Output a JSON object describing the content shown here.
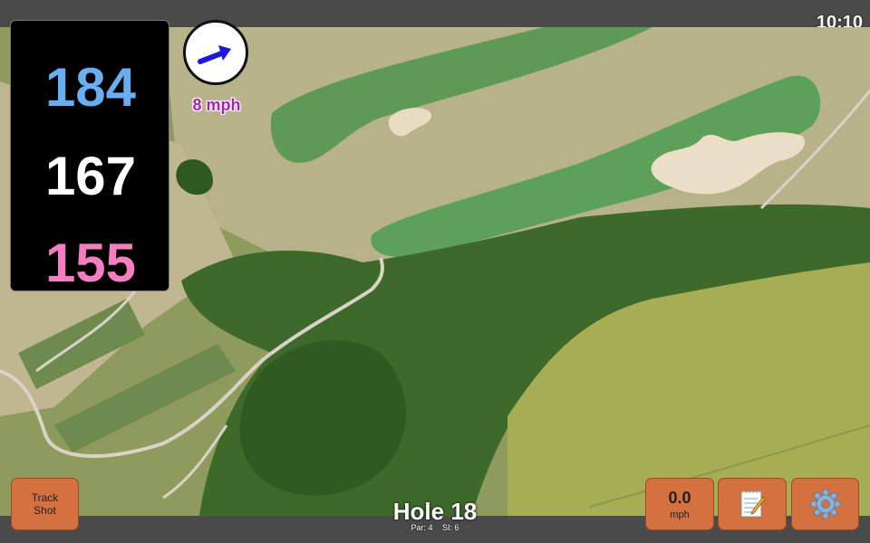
{
  "status_bar": {
    "clock": "10:10"
  },
  "distances": {
    "back": "184",
    "middle": "167",
    "front": "155",
    "colors": {
      "back": "#6aaef2",
      "middle": "#ffffff",
      "front": "#f47ec0"
    }
  },
  "wind": {
    "speed_text": "8 mph",
    "arrow_icon": "arrow-east-northeast-icon",
    "arrow_color": "#1a1adf",
    "speed_color": "#b020b0"
  },
  "hole": {
    "title": "Hole 18",
    "par": "Par: 4",
    "stroke_index": "SI: 6"
  },
  "buttons": {
    "track_shot": "Track\nShot",
    "speed_value": "0.0",
    "speed_unit": "mph",
    "notes_icon": "notepad-icon",
    "settings_icon": "gear-icon",
    "color": "#d4713f"
  }
}
